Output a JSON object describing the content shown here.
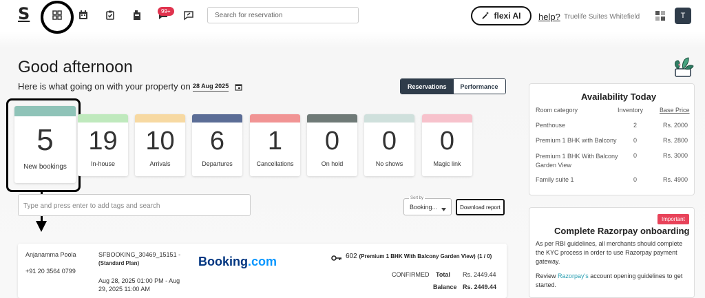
{
  "header": {
    "logo": "S",
    "notification_badge": "99+",
    "search_placeholder": "Search for reservation",
    "flexi_label": "flexi AI",
    "help_label": "help?",
    "property_name": "Truelife Suites Whitefield",
    "avatar_initial": "T"
  },
  "main": {
    "greeting": "Good afternoon",
    "subline": "Here is what going on with your property on",
    "date": "28 Aug 2025",
    "tabs": [
      "Reservations",
      "Performance"
    ],
    "stats": [
      {
        "value": "5",
        "label": "New bookings",
        "color": "#8fc3b8"
      },
      {
        "value": "19",
        "label": "In-house",
        "color": "#bfe9bd"
      },
      {
        "value": "10",
        "label": "Arrivals",
        "color": "#f7d9a2"
      },
      {
        "value": "6",
        "label": "Departures",
        "color": "#5b6d96"
      },
      {
        "value": "1",
        "label": "Cancellations",
        "color": "#f19494"
      },
      {
        "value": "0",
        "label": "On hold",
        "color": "#6f7a77"
      },
      {
        "value": "0",
        "label": "No shows",
        "color": "#cfe0dc"
      },
      {
        "value": "0",
        "label": "Magic link",
        "color": "#f7c2cc"
      }
    ],
    "tags_placeholder": "Type and press enter to add tags and search",
    "sort_label": "Sort by",
    "sort_value": "Booking...",
    "download_label": "Download report"
  },
  "reservation": {
    "guest_name": "Anjanamma Poola",
    "phone": "+91 20 3564 0799",
    "booking_id": "SFBOOKING_30469_15151 -",
    "plan": "(Standard Plan)",
    "dates": "Aug 28, 2025 01:00 PM - Aug 29, 2025 11:00 AM",
    "source_logo_main": "Booking",
    "source_logo_suffix": ".com",
    "room_number": "602",
    "room_type": "(Premium 1 BHK With Balcony Garden View)",
    "room_count": "(1 / 0)",
    "status": "CONFIRMED",
    "total_label": "Total",
    "total_value": "Rs. 2449.44",
    "balance_label": "Balance",
    "balance_value": "Rs. 2449.44"
  },
  "availability": {
    "title": "Availability Today",
    "columns": [
      "Room category",
      "Inventory",
      "Base Price"
    ],
    "rows": [
      {
        "category": "Penthouse",
        "inventory": "2",
        "price": "Rs. 2000"
      },
      {
        "category": "Premium 1 BHK with Balcony",
        "inventory": "0",
        "price": "Rs. 2800"
      },
      {
        "category": "Premium 1 BHK With Balcony Garden View",
        "inventory": "0",
        "price": "Rs. 3000"
      },
      {
        "category": "Family suite 1",
        "inventory": "0",
        "price": "Rs. 4900"
      }
    ]
  },
  "razorpay": {
    "badge": "Important",
    "title": "Complete Razorpay onboarding",
    "body": "As per RBI guidelines, all merchants should complete the KYC process in order to use Razorpay payment gateway.",
    "review_prefix": "Review",
    "review_link": "Razorpay's",
    "review_suffix": "account opening guidelines to get started."
  }
}
